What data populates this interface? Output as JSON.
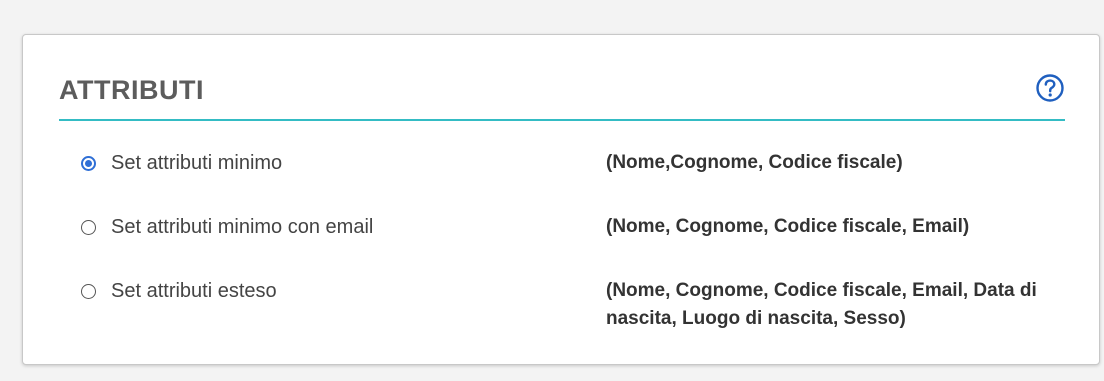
{
  "section": {
    "title": "ATTRIBUTI",
    "help_icon": "question-circle-icon",
    "accent_color": "#34bcc4",
    "help_color": "#1f5fbf"
  },
  "options": [
    {
      "label": "Set attributi minimo",
      "description": "(Nome,Cognome, Codice fiscale)",
      "selected": true
    },
    {
      "label": "Set attributi minimo con email",
      "description": "(Nome, Cognome, Codice fiscale, Email)",
      "selected": false
    },
    {
      "label": "Set attributi esteso",
      "description": "(Nome, Cognome, Codice fiscale, Email, Data di nascita, Luogo di nascita, Sesso)",
      "selected": false
    }
  ]
}
